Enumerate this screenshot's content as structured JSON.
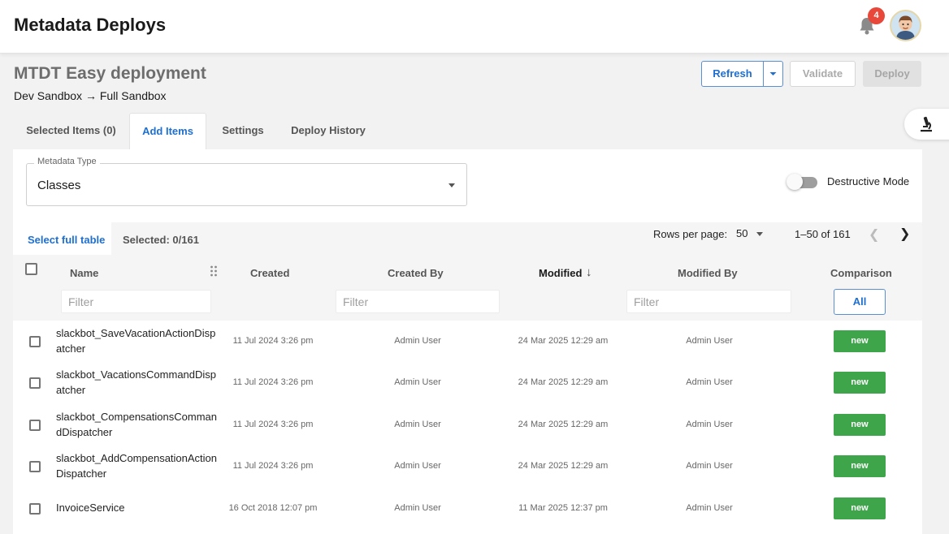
{
  "header": {
    "title": "Metadata Deploys",
    "notification_count": "4"
  },
  "page": {
    "title": "MTDT Easy deployment",
    "subtitle": "Dev Sandbox → Full Sandbox"
  },
  "actions": {
    "refresh": "Refresh",
    "validate": "Validate",
    "deploy": "Deploy"
  },
  "tabs": [
    {
      "label": "Selected Items (0)"
    },
    {
      "label": "Add Items",
      "active": true
    },
    {
      "label": "Settings"
    },
    {
      "label": "Deploy History"
    }
  ],
  "metadata_type": {
    "label": "Metadata Type",
    "value": "Classes"
  },
  "destructive_mode": {
    "label": "Destructive Mode",
    "enabled": false
  },
  "selection": {
    "select_full_label": "Select full table",
    "selected": "Selected: 0/161"
  },
  "pagination": {
    "rows_per_page_label": "Rows per page:",
    "rows_per_page": "50",
    "range": "1–50 of 161"
  },
  "table": {
    "columns": {
      "name": "Name",
      "created": "Created",
      "created_by": "Created By",
      "modified": "Modified",
      "modified_by": "Modified By",
      "comparison": "Comparison"
    },
    "filter_placeholder": "Filter",
    "comparison_all": "All",
    "rows": [
      {
        "name": "slackbot_SaveVacationActionDispatcher",
        "created": "11 Jul 2024 3:26 pm",
        "created_by": "Admin User",
        "modified": "24 Mar 2025 12:29 am",
        "modified_by": "Admin User",
        "comparison": "new"
      },
      {
        "name": "slackbot_VacationsCommandDispatcher",
        "created": "11 Jul 2024 3:26 pm",
        "created_by": "Admin User",
        "modified": "24 Mar 2025 12:29 am",
        "modified_by": "Admin User",
        "comparison": "new"
      },
      {
        "name": "slackbot_CompensationsCommandDispatcher",
        "created": "11 Jul 2024 3:26 pm",
        "created_by": "Admin User",
        "modified": "24 Mar 2025 12:29 am",
        "modified_by": "Admin User",
        "comparison": "new"
      },
      {
        "name": "slackbot_AddCompensationActionDispatcher",
        "created": "11 Jul 2024 3:26 pm",
        "created_by": "Admin User",
        "modified": "24 Mar 2025 12:29 am",
        "modified_by": "Admin User",
        "comparison": "new"
      },
      {
        "name": "InvoiceService",
        "created": "16 Oct 2018 12:07 pm",
        "created_by": "Admin User",
        "modified": "11 Mar 2025 12:37 pm",
        "modified_by": "Admin User",
        "comparison": "new"
      }
    ]
  },
  "colors": {
    "accent": "#1e6fd0",
    "new_badge": "#3fa54a",
    "notification": "#e8483a"
  }
}
